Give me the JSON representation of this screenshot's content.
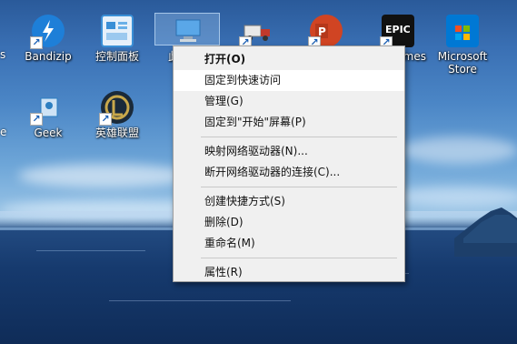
{
  "desktop_icons": [
    {
      "name": "bandizip",
      "label": "Bandizip",
      "icon": "bandizip-icon",
      "color": "#1e7fd8"
    },
    {
      "name": "control-panel",
      "label": "控制面板",
      "icon": "control-panel-icon",
      "color": "#3a8fd6"
    },
    {
      "name": "this-pc",
      "label": "此",
      "icon": "computer-icon",
      "color": "#5aa7e8"
    },
    {
      "name": "truck-app",
      "label": "",
      "icon": "truck-icon",
      "color": "#c0392b"
    },
    {
      "name": "powerpoint",
      "label": "",
      "icon": "powerpoint-icon",
      "color": "#d04423"
    },
    {
      "name": "epic-games",
      "label": "mes",
      "icon": "epic-games-icon",
      "color": "#111111"
    },
    {
      "name": "microsoft-store",
      "label": "Microsoft\nStore",
      "icon": "store-icon",
      "color": "#0078d4"
    },
    {
      "name": "geek",
      "label": "Geek",
      "icon": "geek-icon",
      "color": "#2d7fc1"
    },
    {
      "name": "league",
      "label": "英雄联盟",
      "icon": "league-icon",
      "color": "#1a2a3a"
    }
  ],
  "context_menu": {
    "items": [
      {
        "label": "打开(O)",
        "bold": true,
        "highlight": false
      },
      {
        "label": "固定到快速访问",
        "bold": false,
        "highlight": true
      },
      {
        "label": "管理(G)",
        "bold": false,
        "highlight": false
      },
      {
        "label": "固定到\"开始\"屏幕(P)",
        "bold": false,
        "highlight": false
      },
      {
        "separator": true
      },
      {
        "label": "映射网络驱动器(N)...",
        "bold": false,
        "highlight": false
      },
      {
        "label": "断开网络驱动器的连接(C)...",
        "bold": false,
        "highlight": false
      },
      {
        "separator": true
      },
      {
        "label": "创建快捷方式(S)",
        "bold": false,
        "highlight": false
      },
      {
        "label": "删除(D)",
        "bold": false,
        "highlight": false
      },
      {
        "label": "重命名(M)",
        "bold": false,
        "highlight": false
      },
      {
        "separator": true
      },
      {
        "label": "属性(R)",
        "bold": false,
        "highlight": false
      }
    ]
  },
  "colors": {
    "menu_bg": "#f0f0f0",
    "menu_highlight": "#ffffff",
    "label_text": "#ffffff"
  }
}
